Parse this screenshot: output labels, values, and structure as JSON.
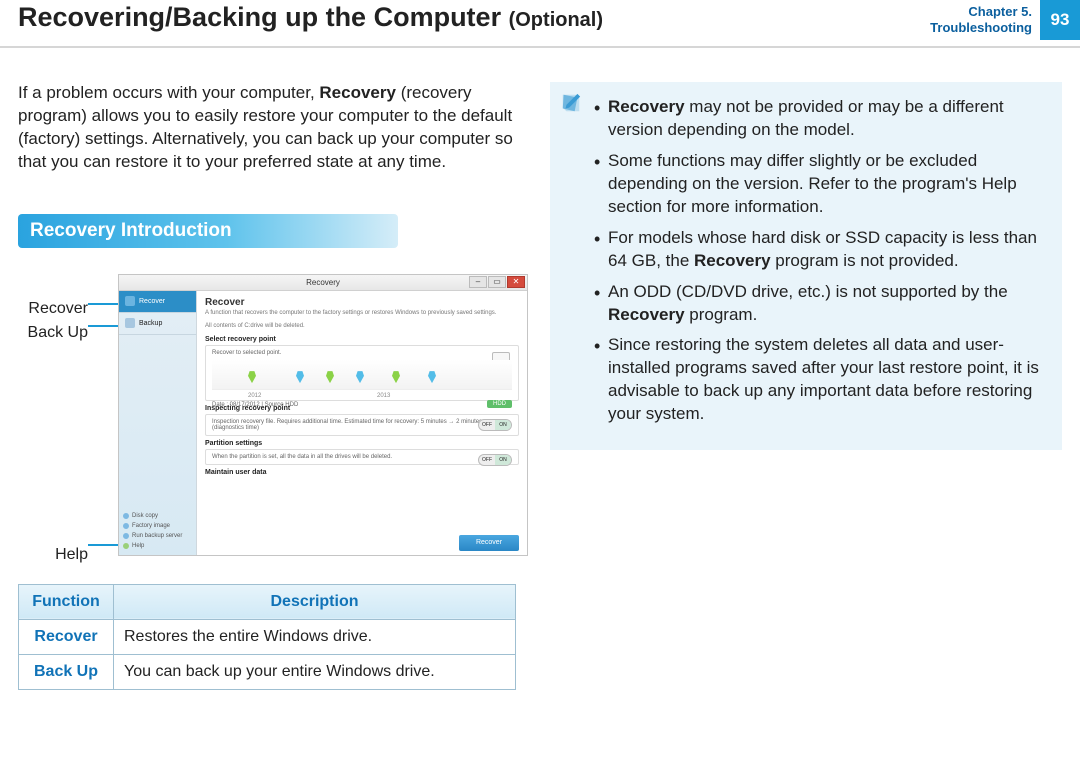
{
  "header": {
    "title_main": "Recovering/Backing up the Computer",
    "title_optional": "(Optional)",
    "chapter_line1": "Chapter 5.",
    "chapter_line2": "Troubleshooting",
    "page_number": "93"
  },
  "intro": {
    "pre": "If a problem occurs with your computer, ",
    "bold": "Recovery",
    "post": " (recovery program) allows you to easily restore your computer to the default (factory) settings. Alternatively, you can back up your computer so that you can restore it to your preferred state at any time."
  },
  "section_bar": "Recovery Introduction",
  "callouts": {
    "recover": "Recover",
    "backup": "Back Up",
    "help": "Help"
  },
  "window": {
    "title": "Recovery",
    "sidebar": {
      "recover": "Recover",
      "backup": "Backup",
      "disk_copy": "Disk copy",
      "factory_image": "Factory image",
      "run_backup_server": "Run backup server",
      "help": "Help"
    },
    "main": {
      "heading": "Recover",
      "sub1": "A function that recovers the computer to the factory settings or restores Windows to previously saved settings.",
      "sub2": "All contents of C:drive will be deleted.",
      "select_label": "Select recovery point",
      "select_sub": "Recover to selected point.",
      "axis_left": "2012",
      "axis_right": "2013",
      "date_line": "Date :  08/17/2012   |   Source   HDD",
      "hdd_badge": "HDD",
      "inspect_label": "Inspecting recovery point",
      "inspect_text": "Inspection recovery file. Requires additional time. Estimated time for recovery: 5 minutes → 2 minutes (diagnostics time)",
      "partition_label": "Partition settings",
      "partition_text": "When the partition is set, all the data in all the drives will be deleted.",
      "maintain_label": "Maintain user data",
      "off": "OFF",
      "on": "ON",
      "button": "Recover"
    }
  },
  "table": {
    "h_function": "Function",
    "h_description": "Description",
    "rows": [
      {
        "fn": "Recover",
        "desc": "Restores the entire Windows drive."
      },
      {
        "fn": "Back Up",
        "desc": "You can back up your entire Windows drive."
      }
    ]
  },
  "tip": {
    "b1_pre": "",
    "b1_bold": "Recovery",
    "b1_post": " may not be provided or may be a different version depending on the model.",
    "b2": "Some functions may differ slightly or be excluded depending on the version. Refer to the program's Help section for more information.",
    "b3_pre": "For models whose hard disk or SSD capacity is less than 64 GB, the ",
    "b3_bold": "Recovery",
    "b3_post": " program is not provided.",
    "b4_pre": "An ODD (CD/DVD drive, etc.) is not supported by the ",
    "b4_bold": "Recovery",
    "b4_post": " program.",
    "b5": "Since restoring the system deletes all data and user-installed programs saved after your last restore point, it is advisable to back up any important data before restoring your system."
  }
}
